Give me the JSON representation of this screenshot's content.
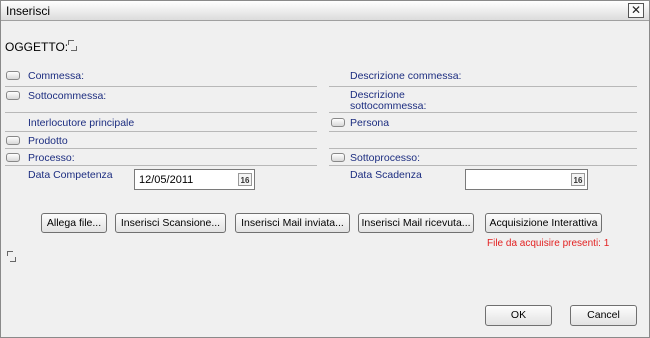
{
  "window": {
    "title": "Inserisci",
    "close_symbol": "✕"
  },
  "oggetto": {
    "label": "OGGETTO:"
  },
  "fields": {
    "commessa": "Commessa:",
    "descrizione_commessa": "Descrizione commessa:",
    "sottocommessa": "Sottocommessa:",
    "descrizione_sottocommessa_1": "Descrizione",
    "descrizione_sottocommessa_2": "sottocommessa:",
    "interlocutore": "Interlocutore principale",
    "persona": "Persona",
    "prodotto": "Prodotto",
    "processo": "Processo:",
    "sottoprocesso": "Sottoprocesso:",
    "data_competenza": "Data Competenza",
    "data_scadenza": "Data Scadenza"
  },
  "dates": {
    "competenza_value": "12/05/2011",
    "scadenza_value": "",
    "calendar_icon_text": "16"
  },
  "actions": {
    "allega": "Allega file...",
    "scansione": "Inserisci Scansione...",
    "mail_inviata": "Inserisci Mail inviata...",
    "mail_ricevuta": "Inserisci Mail ricevuta...",
    "acquisizione": "Acquisizione Interattiva"
  },
  "status": {
    "files_present": "File da acquisire presenti: 1",
    "color": "#e32222"
  },
  "footer": {
    "ok": "OK",
    "cancel": "Cancel"
  },
  "colors": {
    "label_blue": "#1c2d80",
    "background": "#f0f0f0"
  }
}
